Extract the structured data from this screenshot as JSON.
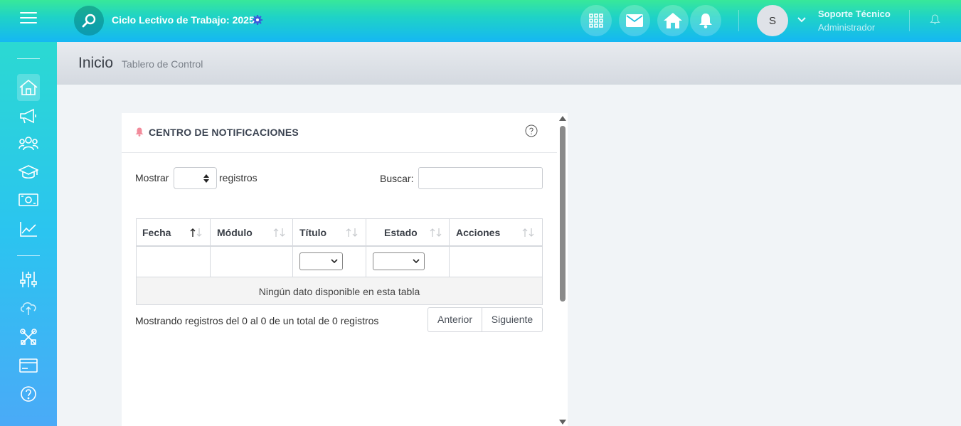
{
  "topbar": {
    "cycle_title": "Ciclo Lectivo de Trabajo: 2025",
    "icons": [
      "apps-grid-icon",
      "mail-icon",
      "home-icon",
      "bell-icon"
    ],
    "user": {
      "initial": "S",
      "name": "Soporte Técnico",
      "role": "Administrador"
    }
  },
  "sidebar": {
    "items": [
      {
        "name": "home-icon",
        "active": true
      },
      {
        "name": "megaphone-icon"
      },
      {
        "name": "users-icon"
      },
      {
        "name": "graduation-cap-icon"
      },
      {
        "name": "money-icon"
      },
      {
        "name": "chart-line-icon"
      },
      {
        "name": "sliders-icon"
      },
      {
        "name": "cloud-upload-icon"
      },
      {
        "name": "tools-icon"
      },
      {
        "name": "credit-card-icon"
      },
      {
        "name": "help-circle-icon"
      }
    ]
  },
  "header": {
    "title": "Inicio",
    "subtitle": "Tablero de Control"
  },
  "card": {
    "title": "CENTRO DE NOTIFICACIONES",
    "length_label_before": "Mostrar",
    "length_label_after": "registros",
    "search_label": "Buscar:",
    "search_value": "",
    "columns": [
      "Fecha",
      "Módulo",
      "Título",
      "Estado",
      "Acciones"
    ],
    "empty_message": "Ningún dato disponible en esta tabla",
    "info": "Mostrando registros del 0 al 0 de un total de 0 registros",
    "pager": {
      "prev": "Anterior",
      "next": "Siguiente"
    }
  },
  "colors": {
    "accent_green": "#38e89a",
    "accent_blue": "#15b7f3",
    "gear": "#3b5bdb",
    "bell": "#f28b9b"
  }
}
